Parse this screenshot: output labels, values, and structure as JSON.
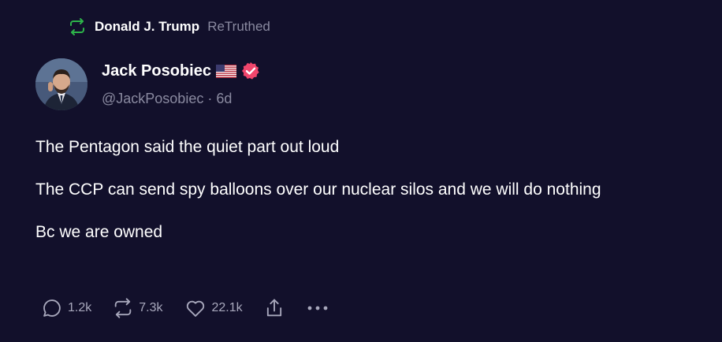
{
  "retruth": {
    "icon": "retruth-icon",
    "user": "Donald J. Trump",
    "label": "ReTruthed",
    "icon_color": "#2db34a"
  },
  "author": {
    "name": "Jack Posobiec",
    "flag_icon": "us-flag-icon",
    "verified_icon": "verified-badge-icon",
    "verified_color": "#f0466c",
    "handle": "@JackPosobiec",
    "separator": "·",
    "time": "6d"
  },
  "post": {
    "paragraphs": [
      "The Pentagon said the quiet part out loud",
      "The CCP can send spy balloons over our nuclear silos and we will do nothing",
      "Bc we are owned"
    ]
  },
  "actions": {
    "replies": "1.2k",
    "retruths": "7.3k",
    "likes": "22.1k",
    "share_icon": "share-icon",
    "more_icon": "more-icon"
  },
  "colors": {
    "background": "#12102b",
    "muted_text": "#8a8aa0"
  }
}
